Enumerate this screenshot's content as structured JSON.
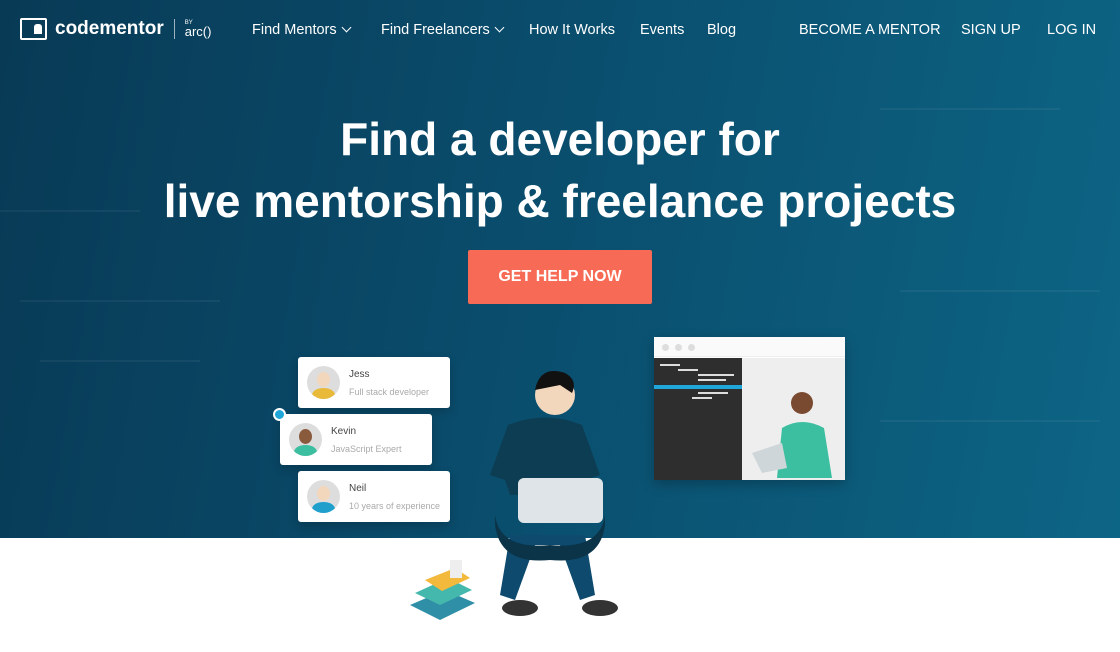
{
  "brand": {
    "name": "codementor",
    "by": "BY",
    "partner": "arc()"
  },
  "nav": {
    "items": [
      {
        "label": "Find Mentors",
        "dropdown": true
      },
      {
        "label": "Find Freelancers",
        "dropdown": true
      },
      {
        "label": "How It Works"
      },
      {
        "label": "Events"
      },
      {
        "label": "Blog"
      }
    ],
    "right": [
      {
        "label": "BECOME A MENTOR"
      },
      {
        "label": "SIGN UP"
      },
      {
        "label": "LOG IN"
      }
    ]
  },
  "hero": {
    "line1": "Find a developer for",
    "line2": "live mentorship & freelance projects",
    "cta": "GET HELP NOW"
  },
  "mentors": [
    {
      "name": "Jess",
      "role": "Full stack developer"
    },
    {
      "name": "Kevin",
      "role": "JavaScript Expert",
      "selected": true
    },
    {
      "name": "Neil",
      "role": "10 years of experience"
    }
  ],
  "colors": {
    "accent": "#f76a55",
    "hero_bg": "#0a4c6c",
    "check": "#1ea7d8"
  }
}
